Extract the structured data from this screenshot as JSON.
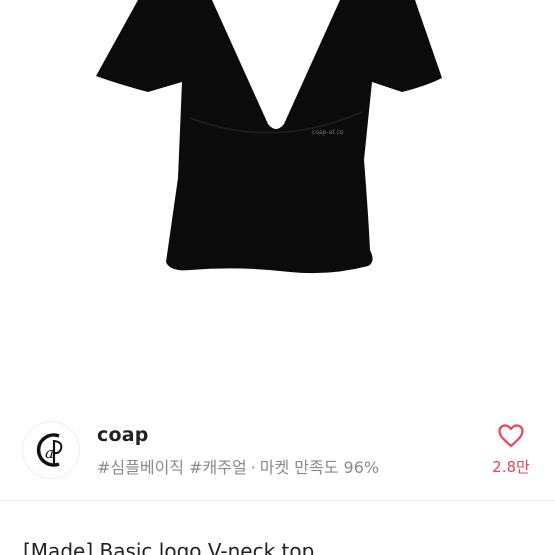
{
  "product": {
    "image_icon": "black-vneck-top-photo",
    "shirt_print": "coap-at.co",
    "title": "[Made] Basic logo V-neck top"
  },
  "shop": {
    "name": "coap",
    "logo_icon": "coap-monogram-logo",
    "logo_text": "CaP",
    "tags": "#심플베이직 #캐주얼",
    "separator": "·",
    "satisfaction": "마켓 만족도 96%"
  },
  "like": {
    "icon": "heart-icon",
    "count": "2.8만",
    "color": "#f0425a"
  }
}
